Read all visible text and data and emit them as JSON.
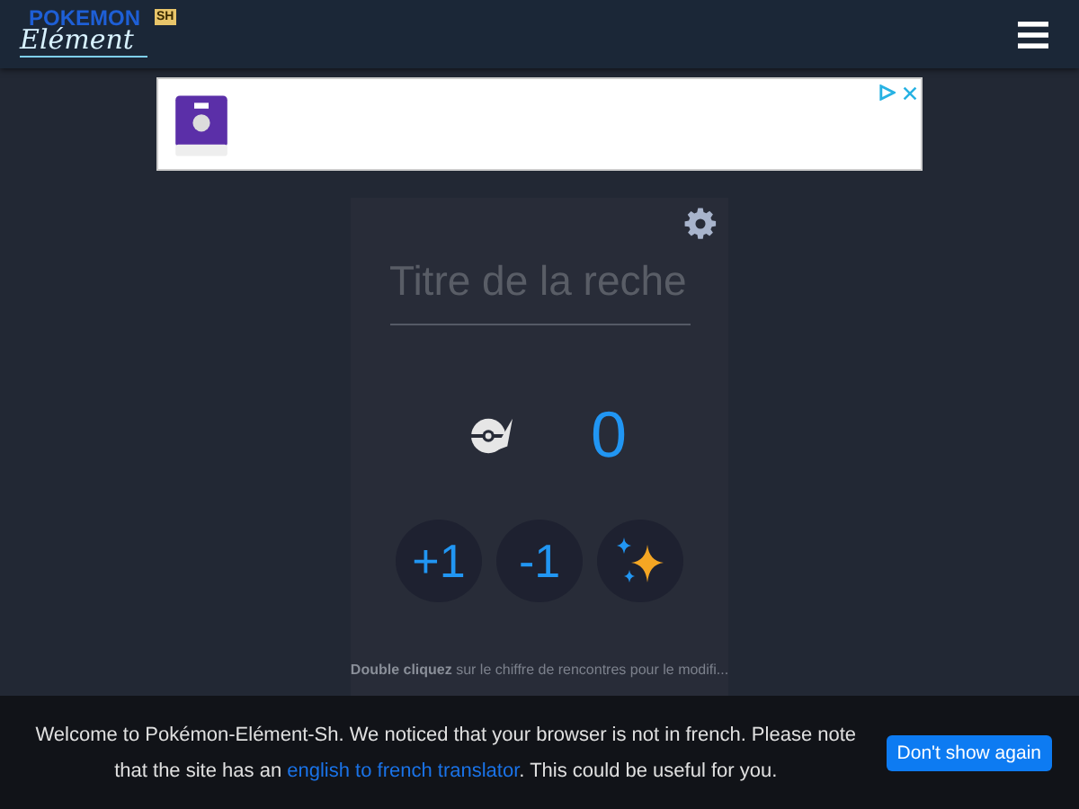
{
  "header": {
    "logo": {
      "top": "POKEMON",
      "script": "Elément",
      "badge": "SH"
    }
  },
  "counter": {
    "title_placeholder": "Titre de la reche",
    "count": "0",
    "buttons": [
      {
        "kind": "text",
        "label": "+1"
      },
      {
        "kind": "text",
        "label": "-1"
      },
      {
        "kind": "shiny"
      }
    ],
    "hint": "**Double cliquez** sur le chiffre de rencontres pour le modifi..."
  },
  "notice": {
    "text_before": "Welcome to Pokémon-Elément-Sh. We noticed that your browser is not in french. Please note that the site has an",
    "link": "english to french translator",
    "text_after": ". This could be useful for you.",
    "button": "Don't show again"
  }
}
